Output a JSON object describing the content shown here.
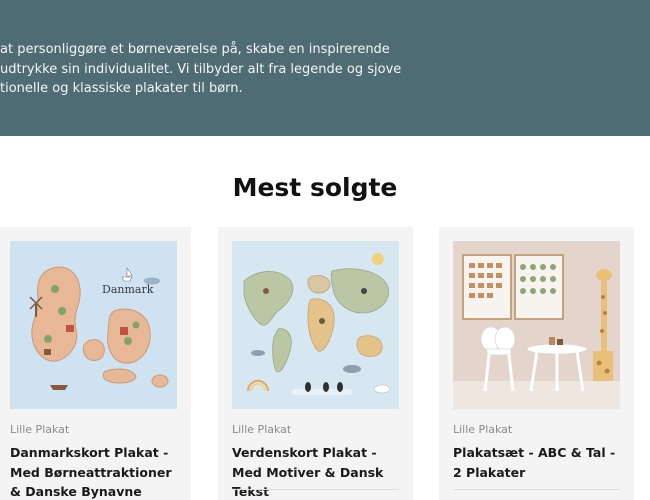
{
  "hero": {
    "text": "at personliggøre et børneværelse på, skabe en inspirerende\nudtrykke sin individualitet. Vi tilbyder alt fra legende og sjove\ntionelle og klassiske plakater til børn."
  },
  "section": {
    "title": "Mest solgte"
  },
  "products": [
    {
      "vendor": "Lille Plakat",
      "title": "Danmarkskort Plakat - Med Børneattraktioner & Danske Bynavne",
      "image_label": "Danmark"
    },
    {
      "vendor": "Lille Plakat",
      "title": "Verdenskort Plakat - Med Motiver & Dansk Tekst"
    },
    {
      "vendor": "Lille Plakat",
      "title": "Plakatsæt - ABC & Tal - 2 Plakater"
    }
  ],
  "colors": {
    "hero_bg": "#4f6b73",
    "card_bg": "#f4f4f4",
    "map_sea": "#cfe2f2",
    "map_land": "#e8b896"
  }
}
